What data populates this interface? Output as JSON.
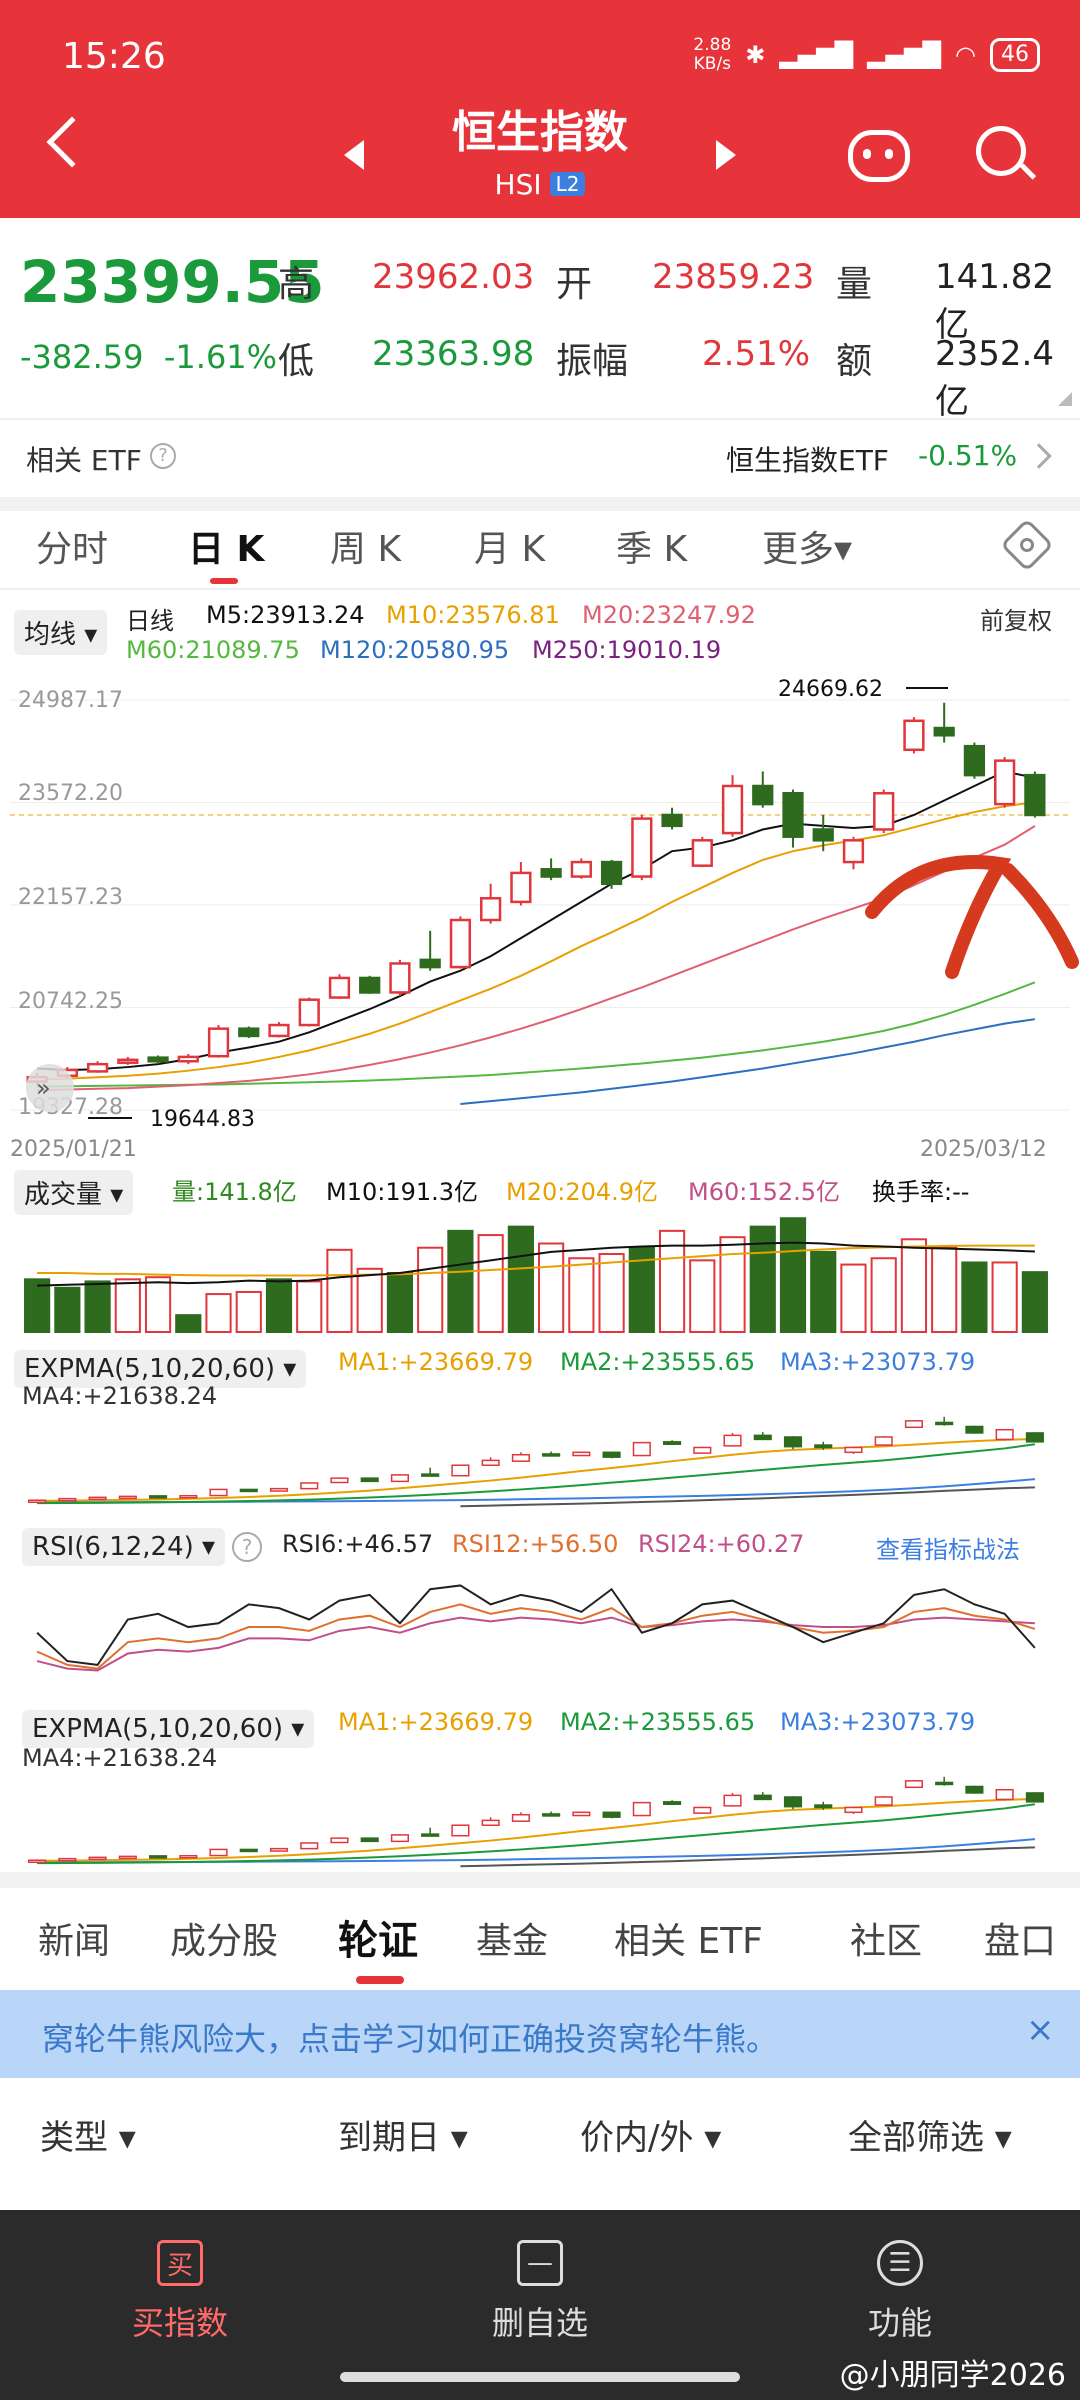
{
  "status": {
    "time": "15:26",
    "speed": "2.88\nKB/s",
    "battery": "46"
  },
  "header": {
    "title": "恒生指数",
    "code": "HSI",
    "level": "L2"
  },
  "quote": {
    "price": "23399.55",
    "change": "-382.59",
    "change_pct": "-1.61%",
    "high_label": "高",
    "high": "23962.03",
    "open_label": "开",
    "open": "23859.23",
    "vol_label": "量",
    "vol": "141.82亿",
    "low_label": "低",
    "low": "23363.98",
    "amp_label": "振幅",
    "amp": "2.51%",
    "amount_label": "额",
    "amount": "2352.4亿"
  },
  "etf": {
    "label": "相关 ETF",
    "name": "恒生指数ETF",
    "change": "-0.51%"
  },
  "ktabs": [
    "分时",
    "日 K",
    "周 K",
    "月 K",
    "季 K",
    "更多▾"
  ],
  "ma": {
    "selector": "均线 ▾",
    "period": "日线",
    "adjust": "前复权",
    "m5": "M5:23913.24",
    "m10": "M10:23576.81",
    "m20": "M20:23247.92",
    "m60": "M60:21089.75",
    "m120": "M120:20580.95",
    "m250": "M250:19010.19"
  },
  "kline_axis": {
    "y_ticks": [
      "24987.17",
      "23572.20",
      "22157.23",
      "20742.25",
      "19327.28"
    ],
    "start_date": "2025/01/21",
    "end_date": "2025/03/12",
    "max_label": "24669.62",
    "min_label": "19644.83"
  },
  "volume": {
    "selector": "成交量 ▾",
    "vol": "量:141.8亿",
    "m10": "M10:191.3亿",
    "m20": "M20:204.9亿",
    "m60": "M60:152.5亿",
    "turnover": "换手率:--"
  },
  "expma1": {
    "selector": "EXPMA(5,10,20,60) ▾",
    "ma1": "MA1:+23669.79",
    "ma2": "MA2:+23555.65",
    "ma3": "MA3:+23073.79",
    "ma4": "MA4:+21638.24"
  },
  "rsi": {
    "selector": "RSI(6,12,24) ▾",
    "rsi6": "RSI6:+46.57",
    "rsi12": "RSI12:+56.50",
    "rsi24": "RSI24:+60.27",
    "link": "查看指标战法"
  },
  "expma2": {
    "selector": "EXPMA(5,10,20,60) ▾",
    "ma1": "MA1:+23669.79",
    "ma2": "MA2:+23555.65",
    "ma3": "MA3:+23073.79",
    "ma4": "MA4:+21638.24"
  },
  "bottom_tabs": [
    "新闻",
    "成分股",
    "轮证",
    "基金",
    "相关 ETF",
    "社区",
    "盘口"
  ],
  "notice": "窝轮牛熊风险大，点击学习如何正确投资窝轮牛熊。",
  "filters": [
    "类型 ▾",
    "到期日 ▾",
    "价内/外 ▾",
    "全部筛选 ▾"
  ],
  "nav": [
    {
      "icon": "买",
      "label": "买指数"
    },
    {
      "icon": "—",
      "label": "删自选"
    },
    {
      "icon": "☰",
      "label": "功能"
    }
  ],
  "watermark": "@小朋同学2026",
  "colors": {
    "up": "#e0363c",
    "down": "#2e6b1e",
    "header": "#e7343a",
    "m5": "#111111",
    "m10": "#e8a000",
    "m20": "#e06070",
    "m60": "#55b840",
    "m120": "#2c6fc0",
    "m250": "#7a2080"
  },
  "chart_data": {
    "type": "candlestick",
    "y_range": [
      19327.28,
      24987.17
    ],
    "candles": [
      {
        "o": 19720,
        "c": 19780,
        "h": 19840,
        "l": 19650
      },
      {
        "o": 19800,
        "c": 19880,
        "h": 19920,
        "l": 19760
      },
      {
        "o": 19860,
        "c": 19960,
        "h": 20000,
        "l": 19840
      },
      {
        "o": 19980,
        "c": 20020,
        "h": 20060,
        "l": 19950
      },
      {
        "o": 20050,
        "c": 20000,
        "h": 20080,
        "l": 19960
      },
      {
        "o": 20000,
        "c": 20060,
        "h": 20100,
        "l": 19960
      },
      {
        "o": 20070,
        "c": 20450,
        "h": 20500,
        "l": 20050
      },
      {
        "o": 20450,
        "c": 20350,
        "h": 20480,
        "l": 20320
      },
      {
        "o": 20350,
        "c": 20500,
        "h": 20540,
        "l": 20330
      },
      {
        "o": 20500,
        "c": 20850,
        "h": 20880,
        "l": 20480
      },
      {
        "o": 20880,
        "c": 21150,
        "h": 21200,
        "l": 20860
      },
      {
        "o": 21150,
        "c": 20950,
        "h": 21180,
        "l": 20930
      },
      {
        "o": 20950,
        "c": 21350,
        "h": 21400,
        "l": 20900
      },
      {
        "o": 21400,
        "c": 21300,
        "h": 21800,
        "l": 21250
      },
      {
        "o": 21300,
        "c": 21950,
        "h": 22000,
        "l": 21280
      },
      {
        "o": 21950,
        "c": 22250,
        "h": 22450,
        "l": 21900
      },
      {
        "o": 22200,
        "c": 22600,
        "h": 22750,
        "l": 22150
      },
      {
        "o": 22650,
        "c": 22550,
        "h": 22800,
        "l": 22500
      },
      {
        "o": 22550,
        "c": 22750,
        "h": 22800,
        "l": 22520
      },
      {
        "o": 22750,
        "c": 22450,
        "h": 22780,
        "l": 22380
      },
      {
        "o": 22550,
        "c": 23350,
        "h": 23400,
        "l": 22500
      },
      {
        "o": 23400,
        "c": 23250,
        "h": 23500,
        "l": 23200
      },
      {
        "o": 22700,
        "c": 23050,
        "h": 23100,
        "l": 22680
      },
      {
        "o": 23150,
        "c": 23800,
        "h": 23950,
        "l": 23100
      },
      {
        "o": 23800,
        "c": 23550,
        "h": 24000,
        "l": 23500
      },
      {
        "o": 23700,
        "c": 23100,
        "h": 23750,
        "l": 22950
      },
      {
        "o": 23200,
        "c": 23050,
        "h": 23400,
        "l": 22900
      },
      {
        "o": 22750,
        "c": 23050,
        "h": 23100,
        "l": 22650
      },
      {
        "o": 23200,
        "c": 23700,
        "h": 23750,
        "l": 23150
      },
      {
        "o": 24300,
        "c": 24700,
        "h": 24750,
        "l": 24250
      },
      {
        "o": 24600,
        "c": 24500,
        "h": 24950,
        "l": 24400
      },
      {
        "o": 24350,
        "c": 23950,
        "h": 24400,
        "l": 23900
      },
      {
        "o": 23550,
        "c": 24150,
        "h": 24200,
        "l": 23500
      },
      {
        "o": 23950,
        "c": 23400,
        "h": 24000,
        "l": 23364
      }
    ],
    "ma5": [
      19900,
      19880,
      19890,
      19920,
      19960,
      20030,
      20120,
      20190,
      20270,
      20400,
      20560,
      20720,
      20900,
      21100,
      21250,
      21450,
      21700,
      21950,
      22200,
      22450,
      22650,
      22900,
      22950,
      23050,
      23200,
      23280,
      23250,
      23220,
      23250,
      23400,
      23600,
      23800,
      24000,
      23913
    ],
    "ma10": [
      19750,
      19760,
      19780,
      19800,
      19830,
      19870,
      19920,
      19980,
      20060,
      20150,
      20260,
      20380,
      20520,
      20680,
      20840,
      21000,
      21180,
      21380,
      21590,
      21780,
      21980,
      22200,
      22400,
      22600,
      22780,
      22900,
      22980,
      23050,
      23120,
      23230,
      23340,
      23440,
      23520,
      23577
    ],
    "ma20": [
      19600,
      19610,
      19620,
      19630,
      19650,
      19670,
      19700,
      19730,
      19770,
      19820,
      19880,
      19950,
      20030,
      20120,
      20220,
      20330,
      20450,
      20580,
      20720,
      20870,
      21020,
      21180,
      21340,
      21500,
      21660,
      21820,
      21970,
      22110,
      22250,
      22430,
      22620,
      22810,
      22990,
      23248
    ],
    "ma60": [
      19650,
      19655,
      19660,
      19665,
      19670,
      19675,
      19680,
      19690,
      19700,
      19710,
      19720,
      19735,
      19750,
      19770,
      19790,
      19810,
      19840,
      19870,
      19900,
      19935,
      19970,
      20010,
      20050,
      20100,
      20150,
      20210,
      20270,
      20340,
      20420,
      20520,
      20640,
      20780,
      20930,
      21090
    ],
    "ma120": [
      null,
      null,
      null,
      null,
      null,
      null,
      null,
      null,
      null,
      null,
      null,
      null,
      null,
      null,
      19410,
      19450,
      19490,
      19530,
      19570,
      19620,
      19670,
      19720,
      19780,
      19840,
      19900,
      19970,
      20040,
      20110,
      20190,
      20270,
      20360,
      20440,
      20520,
      20581
    ],
    "volumes": [
      {
        "v": 125,
        "up": false
      },
      {
        "v": 105,
        "up": false
      },
      {
        "v": 120,
        "up": false
      },
      {
        "v": 125,
        "up": true
      },
      {
        "v": 130,
        "up": true
      },
      {
        "v": 40,
        "up": false
      },
      {
        "v": 90,
        "up": true
      },
      {
        "v": 95,
        "up": true
      },
      {
        "v": 125,
        "up": false
      },
      {
        "v": 120,
        "up": true
      },
      {
        "v": 195,
        "up": true
      },
      {
        "v": 150,
        "up": true
      },
      {
        "v": 140,
        "up": false
      },
      {
        "v": 200,
        "up": true
      },
      {
        "v": 240,
        "up": false
      },
      {
        "v": 230,
        "up": true
      },
      {
        "v": 250,
        "up": false
      },
      {
        "v": 210,
        "up": true
      },
      {
        "v": 175,
        "up": true
      },
      {
        "v": 185,
        "up": true
      },
      {
        "v": 200,
        "up": false
      },
      {
        "v": 240,
        "up": true
      },
      {
        "v": 170,
        "up": true
      },
      {
        "v": 225,
        "up": true
      },
      {
        "v": 250,
        "up": false
      },
      {
        "v": 270,
        "up": false
      },
      {
        "v": 190,
        "up": false
      },
      {
        "v": 160,
        "up": true
      },
      {
        "v": 175,
        "up": true
      },
      {
        "v": 220,
        "up": true
      },
      {
        "v": 200,
        "up": true
      },
      {
        "v": 165,
        "up": false
      },
      {
        "v": 165,
        "up": true
      },
      {
        "v": 142,
        "up": false
      }
    ],
    "vol_ma10": [
      110,
      112,
      114,
      116,
      118,
      116,
      118,
      122,
      120,
      122,
      130,
      135,
      140,
      150,
      160,
      170,
      180,
      190,
      195,
      200,
      203,
      205,
      205,
      207,
      210,
      212,
      210,
      205,
      203,
      200,
      198,
      196,
      194,
      191
    ],
    "vol_ma20": [
      140,
      140,
      138,
      138,
      136,
      135,
      134,
      134,
      134,
      134,
      135,
      136,
      137,
      140,
      143,
      147,
      151,
      155,
      160,
      165,
      170,
      175,
      180,
      185,
      188,
      192,
      196,
      199,
      201,
      203,
      204,
      205,
      205,
      205
    ],
    "rsi6": [
      55,
      40,
      38,
      62,
      65,
      58,
      60,
      70,
      68,
      62,
      72,
      75,
      60,
      78,
      80,
      70,
      75,
      72,
      66,
      78,
      55,
      60,
      70,
      72,
      65,
      58,
      50,
      55,
      60,
      75,
      78,
      70,
      65,
      47
    ],
    "rsi12": [
      45,
      38,
      36,
      50,
      52,
      50,
      52,
      58,
      58,
      56,
      62,
      64,
      58,
      66,
      70,
      65,
      68,
      66,
      62,
      68,
      58,
      60,
      64,
      66,
      62,
      58,
      55,
      56,
      58,
      66,
      68,
      64,
      62,
      57
    ],
    "rsi24": [
      40,
      36,
      35,
      44,
      46,
      45,
      47,
      52,
      52,
      51,
      56,
      58,
      55,
      60,
      63,
      61,
      63,
      62,
      60,
      63,
      58,
      59,
      61,
      62,
      61,
      59,
      58,
      58,
      59,
      62,
      63,
      62,
      61,
      60
    ]
  }
}
